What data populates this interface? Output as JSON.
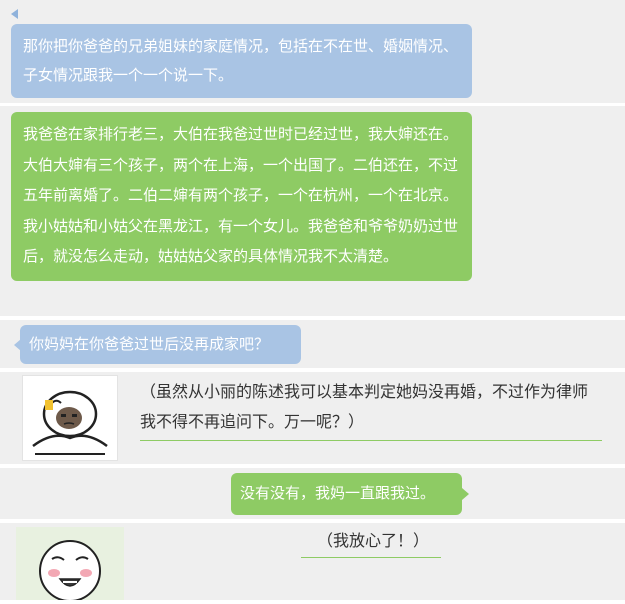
{
  "colors": {
    "question_bubble": "#a9c4e4",
    "answer_bubble": "#8ecb64",
    "band_background": "#efefef",
    "thought_underline": "#8ecb64"
  },
  "messages": [
    {
      "role": "question",
      "text": "那你把你爸爸的兄弟姐妹的家庭情况，包括在不在世、婚姻情况、子女情况跟我一个一个说一下。"
    },
    {
      "role": "answer",
      "text": "我爸爸在家排行老三，大伯在我爸过世时已经过世，我大婶还在。大伯大婶有三个孩子，两个在上海，一个出国了。二伯还在，不过五年前离婚了。二伯二婶有两个孩子，一个在杭州，一个在北京。我小姑姑和小姑父在黑龙江，有一个女儿。我爸爸和爷爷奶奶过世后，就没怎么走动，姑姑姑父家的具体情况我不太清楚。"
    },
    {
      "role": "question",
      "text": "你妈妈在你爸爸过世后没再成家吧？"
    },
    {
      "role": "thought",
      "text": "（虽然从小丽的陈述我可以基本判定她妈没再婚，不过作为律师我不得不再追问下。万一呢？）",
      "icon": "lawyer-meme-icon"
    },
    {
      "role": "answer",
      "text": "没有没有，我妈一直跟我过。"
    },
    {
      "role": "thought",
      "text": "（我放心了！）",
      "icon": "relieved-face-meme-icon"
    }
  ]
}
